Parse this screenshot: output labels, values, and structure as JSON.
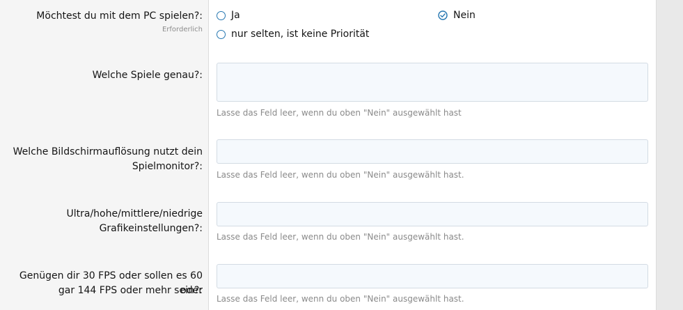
{
  "questions": {
    "pc_play": {
      "label": "Möchtest du mit dem PC spielen?:",
      "required": "Erforderlich",
      "options": [
        "Ja",
        "Nein",
        "nur selten, ist keine Priorität"
      ],
      "selected": "Nein"
    },
    "games": {
      "label": "Welche Spiele genau?:",
      "value": "",
      "hint": "Lasse das Feld leer, wenn du oben \"Nein\" ausgewählt hast"
    },
    "resolution": {
      "label_line1": "Welche Bildschirmauflösung nutzt dein",
      "label_line2": "Spielmonitor?:",
      "value": "",
      "hint": "Lasse das Feld leer, wenn du oben \"Nein\" ausgewählt hast."
    },
    "graphics": {
      "label_line1": "Ultra/hohe/mittlere/niedrige",
      "label_line2": "Grafikeinstellungen?:",
      "value": "",
      "hint": "Lasse das Feld leer, wenn du oben \"Nein\" ausgewählt hast."
    },
    "fps": {
      "label_line1": "Genügen dir 30 FPS oder sollen es 60 oder",
      "label_line2": "gar 144 FPS oder mehr sein?:",
      "value": "",
      "hint": "Lasse das Feld leer, wenn du oben \"Nein\" ausgewählt hast."
    }
  },
  "colors": {
    "accent": "#2577b1",
    "field_bg": "#f5f9fd",
    "label_bg": "#f5f5f5"
  }
}
